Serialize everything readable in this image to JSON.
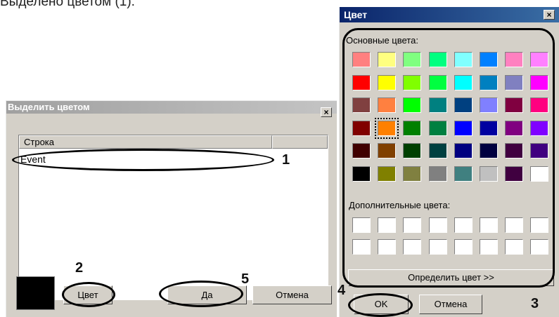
{
  "top_text": "Выделено цветом (1).",
  "left_dialog": {
    "title": "Выделить цветом",
    "close": "×",
    "column_header": "Строка",
    "rows": [
      "Event"
    ],
    "color_button": "Цвет",
    "yes_button": "Да",
    "cancel_button": "Отмена",
    "preview_color": "#000000"
  },
  "right_dialog": {
    "title": "Цвет",
    "close": "×",
    "basic_label": "Основные цвета:",
    "custom_label": "Дополнительные цвета:",
    "define_button": "Определить цвет >>",
    "ok_button": "OK",
    "cancel_button": "Отмена",
    "selected_index": 25,
    "basic_colors": [
      "#ff8080",
      "#ffff80",
      "#80ff80",
      "#00ff80",
      "#80ffff",
      "#0080ff",
      "#ff80c0",
      "#ff80ff",
      "#ff0000",
      "#ffff00",
      "#80ff00",
      "#00ff40",
      "#00ffff",
      "#0080c0",
      "#8080c0",
      "#ff00ff",
      "#804040",
      "#ff8040",
      "#00ff00",
      "#008080",
      "#004080",
      "#8080ff",
      "#800040",
      "#ff0080",
      "#800000",
      "#ff8000",
      "#008000",
      "#008040",
      "#0000ff",
      "#0000a0",
      "#800080",
      "#8000ff",
      "#400000",
      "#804000",
      "#004000",
      "#004040",
      "#000080",
      "#000040",
      "#400040",
      "#400080",
      "#000000",
      "#808000",
      "#808040",
      "#808080",
      "#408080",
      "#c0c0c0",
      "#400040",
      "#ffffff"
    ],
    "custom_colors": [
      "#ffffff",
      "#ffffff",
      "#ffffff",
      "#ffffff",
      "#ffffff",
      "#ffffff",
      "#ffffff",
      "#ffffff",
      "#ffffff",
      "#ffffff",
      "#ffffff",
      "#ffffff",
      "#ffffff",
      "#ffffff",
      "#ffffff",
      "#ffffff"
    ]
  },
  "annotations": [
    "1",
    "2",
    "3",
    "4",
    "5"
  ]
}
